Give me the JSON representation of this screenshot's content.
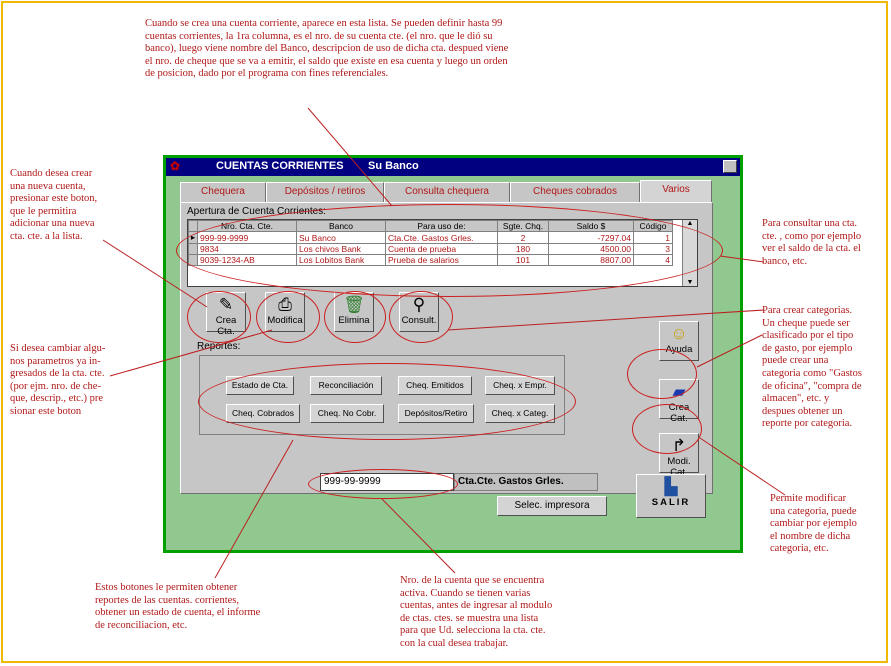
{
  "notes": {
    "top": [
      "Cuando se crea una cuenta corriente, aparece en esta lista. Se pueden definir hasta 99",
      "cuentas corrientes, la 1ra columna, es el nro. de su cuenta cte. (el nro. que le dió su",
      "banco), luego viene nombre del Banco, descripcion de uso de dicha cta. despued viene",
      "el nro. de cheque que se va a emitir, el saldo que existe en esa cuenta y luego un orden",
      "de posicion, dado por el programa con fines referenciales."
    ],
    "left_top": [
      "Cuando desea crear",
      "una nueva cuenta,",
      "presionar este boton,",
      "que le permitira",
      "adicionar una nueva",
      "cta. cte. a la lista."
    ],
    "left_mid": [
      "Si desea cambiar algu-",
      "nos parametros ya in-",
      "gresados de la cta. cte.",
      "(por ejm. nro. de che-",
      "que, descrip., etc.) pre",
      "sionar este boton"
    ],
    "bottom_left": [
      "Estos botones le permiten obtener",
      "reportes de las cuentas. corrientes,",
      "obtener un estado de cuenta, el informe",
      "de reconciliacion, etc."
    ],
    "bottom_mid": [
      "Nro. de la cuenta que se encuentra",
      "activa. Cuando se tienen varias",
      "cuentas, antes de ingresar al modulo",
      "de ctas. ctes. se muestra una lista",
      "para que Ud. selecciona la cta. cte.",
      "con la cual desea trabajar."
    ],
    "right_top": [
      "Para consultar una cta.",
      "cte. , como por ejemplo",
      "ver el saldo de la cta. el",
      "banco, etc."
    ],
    "right_mid": [
      "Para crear categorias.",
      "Un cheque puede ser",
      "clasificado por el tipo",
      "de gasto, por ejemplo",
      "puede crear una",
      "categoria como \"Gastos",
      "de oficina\", \"compra de",
      "almacen\", etc. y",
      "despues obtener un",
      "reporte por categoria."
    ],
    "right_bottom": [
      "Permite modificar",
      "una categoria, puede",
      "cambiar por ejemplo",
      "el nombre de dicha",
      "categoria, etc."
    ]
  },
  "window": {
    "title": "CUENTAS CORRIENTES",
    "subtitle": "Su Banco",
    "tabs": [
      "Chequera",
      "Depósitos / retiros",
      "Consulta chequera",
      "Cheques cobrados",
      "Varios"
    ],
    "active_tab": "Varios",
    "grid_label": "Apertura de Cuenta Corrientes:",
    "columns": [
      "Nro. Cta. Cte.",
      "Banco",
      "Para uso de:",
      "Sgte. Chq.",
      "Saldo  $",
      "Código"
    ],
    "rows": [
      [
        "999-99-9999",
        "Su Banco",
        "Cta.Cte. Gastos Grles.",
        "2",
        "-7297.04",
        "1"
      ],
      [
        "9834",
        "Los chivos Bank",
        "Cuenta de prueba",
        "180",
        "4500.00",
        "3"
      ],
      [
        "9039-1234-AB",
        "Los Lobitos Bank",
        "Prueba de salarios",
        "101",
        "8807.00",
        "4"
      ]
    ],
    "buttons": {
      "crea": "Crea Cta.",
      "modifica": "Modifica",
      "elimina": "Elimina",
      "consult": "Consult.",
      "ayuda": "Ayuda",
      "crea_cat": "Crea Cat.",
      "modi_cat": "Modi. Cat."
    },
    "reportes_label": "Reportes:",
    "reports": [
      "Estado de Cta.",
      "Reconciliación",
      "Cheq. Emitidos",
      "Cheq. x Empr.",
      "Cheq. Cobrados",
      "Cheq. No Cobr.",
      "Depósitos/Retiro",
      "Cheq. x Categ."
    ],
    "active_account": "999-99-9999",
    "active_desc": "Cta.Cte. Gastos Grles.",
    "print_button": "Selec. impresora",
    "exit_button": "SALIR"
  }
}
